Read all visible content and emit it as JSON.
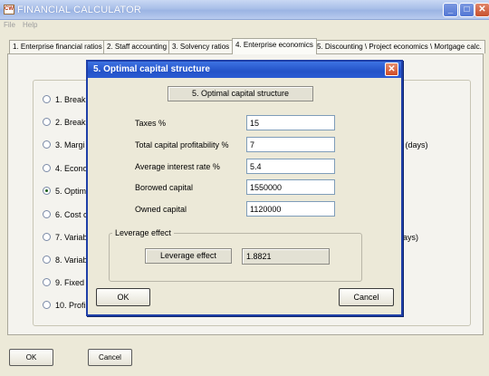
{
  "window": {
    "title": "FINANCIAL CALCULATOR",
    "icon_text": "CW",
    "minimize": "_",
    "maximize": "□",
    "close": "✕"
  },
  "menu": [
    "File",
    "Help"
  ],
  "tabs": [
    {
      "label": "1. Enterprise financial ratios"
    },
    {
      "label": "2. Staff accounting"
    },
    {
      "label": "3. Solvency ratios"
    },
    {
      "label": "4. Enterprise economics"
    },
    {
      "label": "5. Discounting \\ Project economics \\ Mortgage calc."
    }
  ],
  "options": [
    {
      "label": "1. Break",
      "selected": false
    },
    {
      "label": "2. Break",
      "selected": false
    },
    {
      "label": "3. Margi",
      "selected": false
    },
    {
      "label": "4. Econo",
      "selected": false
    },
    {
      "label": "5. Optim",
      "selected": true
    },
    {
      "label": "6. Cost c",
      "selected": false
    },
    {
      "label": "7. Variab",
      "selected": false
    },
    {
      "label": "8. Variab",
      "selected": false
    },
    {
      "label": "9. Fixed",
      "selected": false
    },
    {
      "label": "10. Profi",
      "selected": false
    }
  ],
  "right_fragments": {
    "row3": "d (days)",
    "row7": "days)"
  },
  "main_buttons": {
    "ok": "OK",
    "cancel": "Cancel"
  },
  "dialog": {
    "title": "5. Optimal capital structure",
    "header": "5. Optimal capital structure",
    "close": "✕",
    "fields": [
      {
        "label": "Taxes %",
        "value": "15"
      },
      {
        "label": "Total capital profitability %",
        "value": "7"
      },
      {
        "label": "Average interest rate %",
        "value": "5.4"
      },
      {
        "label": "Borowed capital",
        "value": "1550000"
      },
      {
        "label": "Owned capital",
        "value": "1120000"
      }
    ],
    "leverage": {
      "group_label": "Leverage effect",
      "label": "Leverage effect",
      "value": "1.8821"
    },
    "ok": "OK",
    "cancel": "Cancel"
  }
}
